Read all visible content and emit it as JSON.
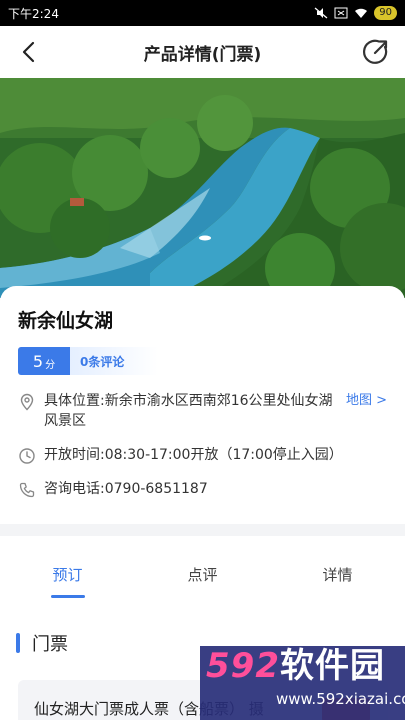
{
  "status_bar": {
    "time": "下午2:24",
    "battery": "90"
  },
  "nav": {
    "title": "产品详情(门票)"
  },
  "place": {
    "name": "新余仙女湖",
    "score": "5",
    "score_unit": "分",
    "review_count": "0条评论",
    "location_label": "具体位置:",
    "location": "新余市渝水区西南郊16公里处仙女湖风景区",
    "map_link": "地图 >",
    "hours_label": "开放时间:",
    "hours": "08:30-17:00开放（17:00停止入园）",
    "phone_label": "咨询电话:",
    "phone": "0790-6851187"
  },
  "tabs": [
    {
      "label": "预订",
      "active": true
    },
    {
      "label": "点评",
      "active": false
    },
    {
      "label": "详情",
      "active": false
    }
  ],
  "section": {
    "title": "门票"
  },
  "ticket": {
    "name": "仙女湖大门票成人票（含船票）  摄"
  },
  "watermark": {
    "brand_num": "592",
    "brand_text": "软件园",
    "url": "www.592xiazai.com"
  },
  "colors": {
    "accent": "#3b7ae8",
    "buy": "#e8542e"
  }
}
